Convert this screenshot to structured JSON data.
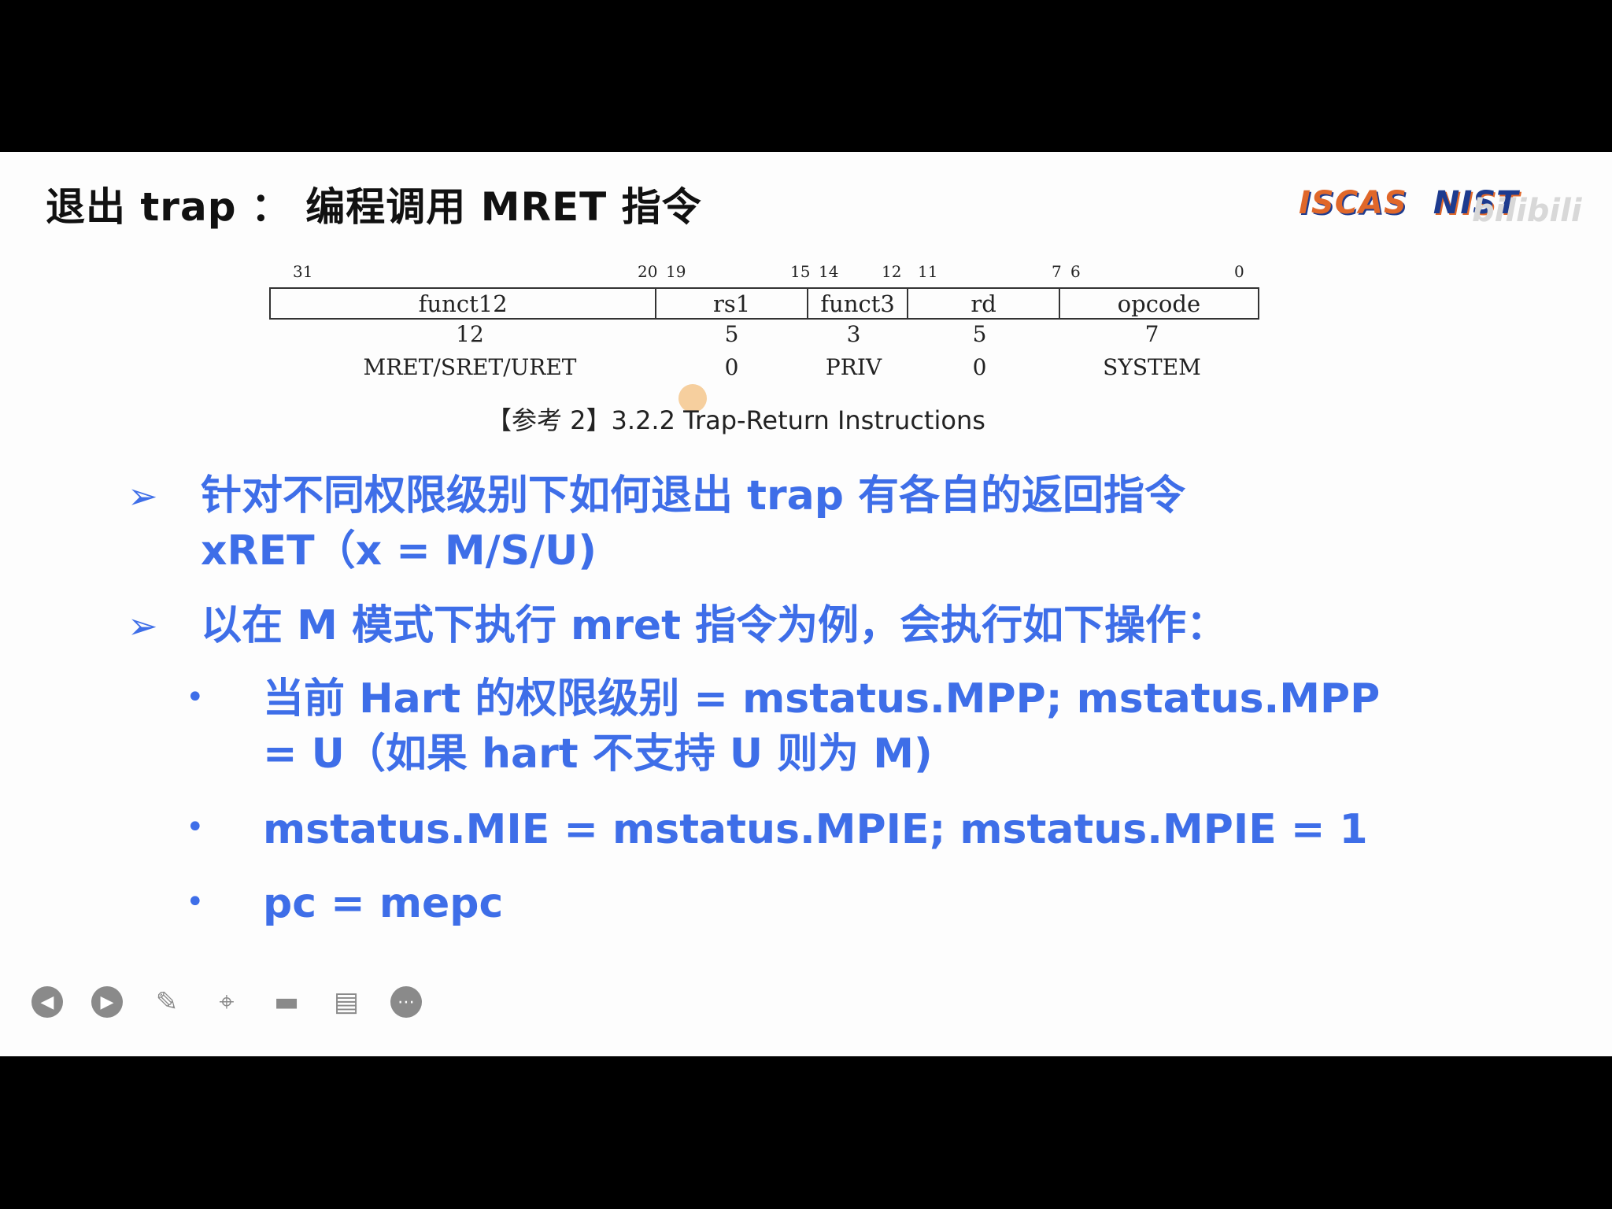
{
  "slide": {
    "title": "退出 trap ： 编程调用 MRET 指令",
    "logos": [
      "ISCAS",
      "NIST"
    ],
    "watermark": "bilibili"
  },
  "format": {
    "bit_labels": [
      "31",
      "20",
      "19",
      "15",
      "14",
      "12",
      "11",
      "7",
      "6",
      "0"
    ],
    "fields": [
      "funct12",
      "rs1",
      "funct3",
      "rd",
      "opcode"
    ],
    "widths": [
      "12",
      "5",
      "3",
      "5",
      "7"
    ],
    "values": [
      "MRET/SRET/URET",
      "0",
      "PRIV",
      "0",
      "SYSTEM"
    ],
    "caption": "【参考 2】3.2.2 Trap-Return Instructions"
  },
  "bullets": {
    "b1_line1": "针对不同权限级别下如何退出 trap 有各自的返回指令",
    "b1_line2": "xRET（x = M/S/U)",
    "b2": "以在 M 模式下执行 mret 指令为例，会执行如下操作：",
    "s1_line1": "当前 Hart 的权限级别 = mstatus.MPP; mstatus.MPP",
    "s1_line2": "= U（如果 hart 不支持 U 则为 M)",
    "s2": "mstatus.MIE = mstatus.MPIE; mstatus.MPIE = 1",
    "s3": "pc = mepc"
  },
  "toolbar": {
    "icons": [
      "prev-icon",
      "next-icon",
      "pen-icon",
      "screenshot-icon",
      "camera-icon",
      "comment-icon",
      "more-icon"
    ]
  }
}
